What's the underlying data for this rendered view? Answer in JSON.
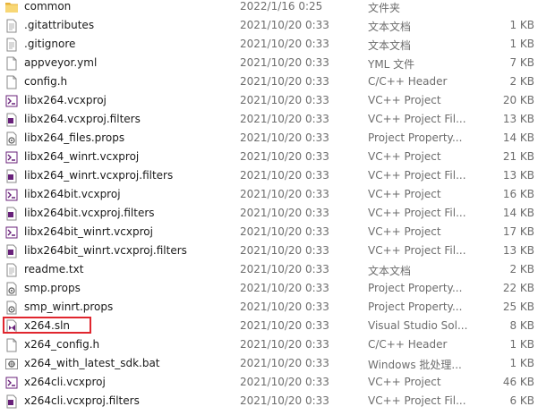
{
  "colors": {
    "highlight_border": "#e0262e",
    "folder": "#f5c84c",
    "vs_purple": "#68217a"
  },
  "files": [
    {
      "name": "common",
      "date": "2022/1/16 0:25",
      "type": "文件夹",
      "size": "",
      "icon": "folder-icon"
    },
    {
      "name": ".gitattributes",
      "date": "2021/10/20 0:33",
      "type": "文本文档",
      "size": "1 KB",
      "icon": "text-file-icon"
    },
    {
      "name": ".gitignore",
      "date": "2021/10/20 0:33",
      "type": "文本文档",
      "size": "1 KB",
      "icon": "text-file-icon"
    },
    {
      "name": "appveyor.yml",
      "date": "2021/10/20 0:33",
      "type": "YML 文件",
      "size": "7 KB",
      "icon": "blank-file-icon"
    },
    {
      "name": "config.h",
      "date": "2021/10/20 0:33",
      "type": "C/C++ Header",
      "size": "2 KB",
      "icon": "header-file-icon"
    },
    {
      "name": "libx264.vcxproj",
      "date": "2021/10/20 0:33",
      "type": "VC++ Project",
      "size": "20 KB",
      "icon": "vcxproj-icon"
    },
    {
      "name": "libx264.vcxproj.filters",
      "date": "2021/10/20 0:33",
      "type": "VC++ Project Fil...",
      "size": "13 KB",
      "icon": "filters-icon"
    },
    {
      "name": "libx264_files.props",
      "date": "2021/10/20 0:33",
      "type": "Project Property...",
      "size": "14 KB",
      "icon": "props-icon"
    },
    {
      "name": "libx264_winrt.vcxproj",
      "date": "2021/10/20 0:33",
      "type": "VC++ Project",
      "size": "21 KB",
      "icon": "vcxproj-icon"
    },
    {
      "name": "libx264_winrt.vcxproj.filters",
      "date": "2021/10/20 0:33",
      "type": "VC++ Project Fil...",
      "size": "13 KB",
      "icon": "filters-icon"
    },
    {
      "name": "libx264bit.vcxproj",
      "date": "2021/10/20 0:33",
      "type": "VC++ Project",
      "size": "16 KB",
      "icon": "vcxproj-icon"
    },
    {
      "name": "libx264bit.vcxproj.filters",
      "date": "2021/10/20 0:33",
      "type": "VC++ Project Fil...",
      "size": "14 KB",
      "icon": "filters-icon"
    },
    {
      "name": "libx264bit_winrt.vcxproj",
      "date": "2021/10/20 0:33",
      "type": "VC++ Project",
      "size": "17 KB",
      "icon": "vcxproj-icon"
    },
    {
      "name": "libx264bit_winrt.vcxproj.filters",
      "date": "2021/10/20 0:33",
      "type": "VC++ Project Fil...",
      "size": "13 KB",
      "icon": "filters-icon"
    },
    {
      "name": "readme.txt",
      "date": "2021/10/20 0:33",
      "type": "文本文档",
      "size": "2 KB",
      "icon": "text-file-icon"
    },
    {
      "name": "smp.props",
      "date": "2021/10/20 0:33",
      "type": "Project Property...",
      "size": "22 KB",
      "icon": "props-icon"
    },
    {
      "name": "smp_winrt.props",
      "date": "2021/10/20 0:33",
      "type": "Project Property...",
      "size": "25 KB",
      "icon": "props-icon"
    },
    {
      "name": "x264.sln",
      "date": "2021/10/20 0:33",
      "type": "Visual Studio Sol...",
      "size": "8 KB",
      "icon": "solution-icon",
      "highlighted": true
    },
    {
      "name": "x264_config.h",
      "date": "2021/10/20 0:33",
      "type": "C/C++ Header",
      "size": "1 KB",
      "icon": "header-file-icon"
    },
    {
      "name": "x264_with_latest_sdk.bat",
      "date": "2021/10/20 0:33",
      "type": "Windows 批处理...",
      "size": "1 KB",
      "icon": "batch-file-icon"
    },
    {
      "name": "x264cli.vcxproj",
      "date": "2021/10/20 0:33",
      "type": "VC++ Project",
      "size": "46 KB",
      "icon": "vcxproj-icon"
    },
    {
      "name": "x264cli.vcxproj.filters",
      "date": "2021/10/20 0:33",
      "type": "VC++ Project Fil...",
      "size": "6 KB",
      "icon": "filters-icon"
    }
  ]
}
